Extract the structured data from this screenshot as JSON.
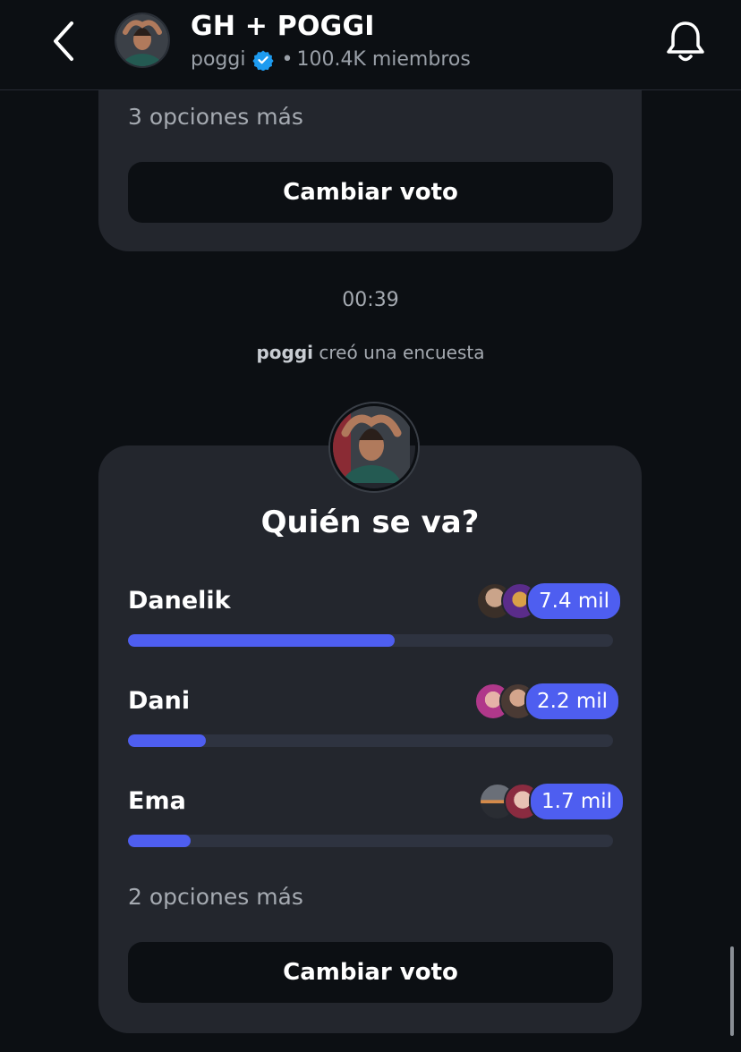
{
  "header": {
    "title": "GH + POGGI",
    "owner": "poggi",
    "separator": "•",
    "members": "100.4K miembros",
    "icons": {
      "back": "chevron-left-icon",
      "verified": "verified-badge-icon",
      "bell": "bell-icon"
    },
    "colors": {
      "verified": "#1d9bf0"
    }
  },
  "previous_poll": {
    "more_options": "3 opciones más",
    "change_vote_label": "Cambiar voto"
  },
  "feed": {
    "timestamp": "00:39",
    "creator": "poggi",
    "system_message": " creó una encuesta"
  },
  "poll": {
    "question": "Quién se va?",
    "options": [
      {
        "name": "Danelik",
        "count": "7.4 mil",
        "fraction": 0.55
      },
      {
        "name": "Dani",
        "count": "2.2 mil",
        "fraction": 0.16
      },
      {
        "name": "Ema",
        "count": "1.7 mil",
        "fraction": 0.13
      }
    ],
    "more_options": "2 opciones más",
    "change_vote_label": "Cambiar voto"
  },
  "colors": {
    "accent": "#4e5ef0",
    "card": "#23262d",
    "background": "#0c0f13",
    "track": "#2e3340"
  }
}
